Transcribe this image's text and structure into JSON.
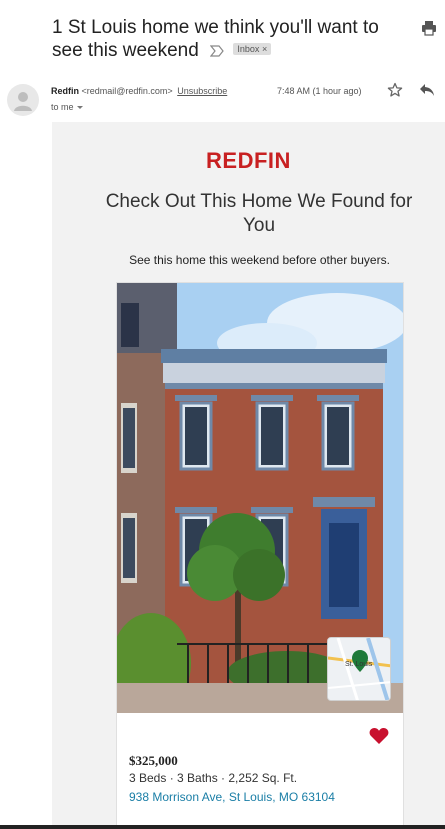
{
  "message": {
    "subject": "1 St Louis home we think you'll want to see this weekend",
    "label_badge": "Inbox",
    "label_badge_close": "×",
    "sender_name": "Redfin",
    "sender_email": "<redmail@redfin.com>",
    "unsubscribe_label": "Unsubscribe",
    "recipient_label": "to me",
    "timestamp": "7:48 AM (1 hour ago)"
  },
  "icons": {
    "print": "print-icon",
    "star": "star-icon",
    "reply": "reply-icon",
    "important": "important-marker-icon",
    "avatar": "default-avatar-icon"
  },
  "body": {
    "logo_text": "REDFIN",
    "headline": "Check Out This Home We Found for You",
    "subline": "See this home this weekend before other buyers."
  },
  "listing": {
    "price": "$325,000",
    "facts": "3 Beds · 3 Baths · 2,252 Sq. Ft.",
    "address": "938 Morrison Ave, St Louis, MO 63104",
    "map_label": "St. Louis",
    "favorited": true
  },
  "colors": {
    "brand_red": "#c82021",
    "link_blue": "#1a7ea6",
    "body_background": "#f2f2f2",
    "heart_red": "#c8102e"
  }
}
